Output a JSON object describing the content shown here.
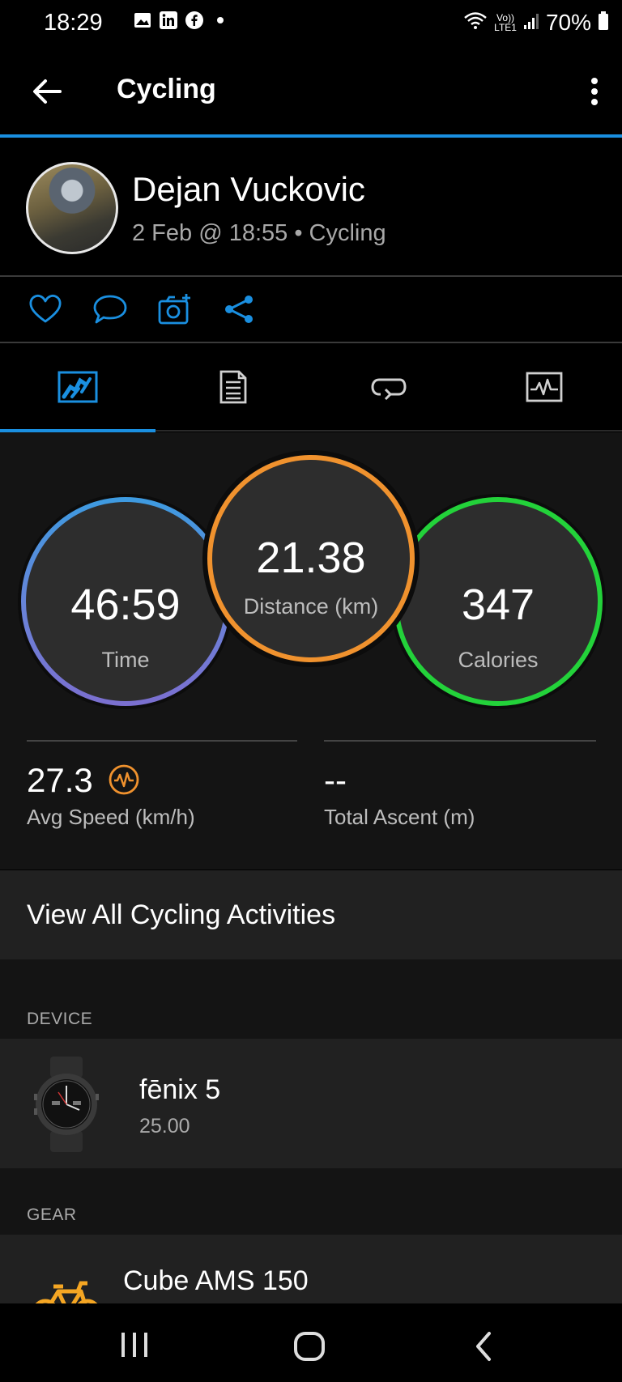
{
  "status_bar": {
    "time": "18:29",
    "battery": "70%",
    "left_icons": [
      "gallery-icon",
      "linkedin-icon",
      "facebook-icon",
      "dot-icon"
    ],
    "right_icons": [
      "wifi-icon",
      "volte-icon",
      "signal-icon",
      "battery-icon"
    ]
  },
  "header": {
    "title": "Cycling"
  },
  "profile": {
    "name": "Dejan Vuckovic",
    "subtitle": "2 Feb @ 18:55 • Cycling"
  },
  "actions": [
    "heart-icon",
    "comment-icon",
    "add-photo-icon",
    "share-icon"
  ],
  "tabs": [
    "stats-tab",
    "details-tab",
    "laps-tab",
    "charts-tab"
  ],
  "rings": {
    "time": {
      "value": "46:59",
      "label": "Time"
    },
    "distance": {
      "value": "21.38",
      "label": "Distance (km)"
    },
    "calories": {
      "value": "347",
      "label": "Calories"
    }
  },
  "metrics": {
    "avg_speed": {
      "value": "27.3",
      "label": "Avg Speed (km/h)"
    },
    "total_ascent": {
      "value": "--",
      "label": "Total Ascent (m)"
    }
  },
  "view_all": "View All Cycling Activities",
  "device": {
    "section": "DEVICE",
    "name": "fēnix 5",
    "version": "25.00"
  },
  "gear": {
    "section": "GEAR",
    "name": "Cube AMS 150"
  },
  "colors": {
    "accent_blue": "#1a8fe0",
    "time_ring_top": "#3d9be0",
    "time_ring_bottom": "#7b6fd0",
    "distance_ring": "#f0922e",
    "calories_ring": "#23d23a",
    "gear_icon": "#f5a623"
  }
}
